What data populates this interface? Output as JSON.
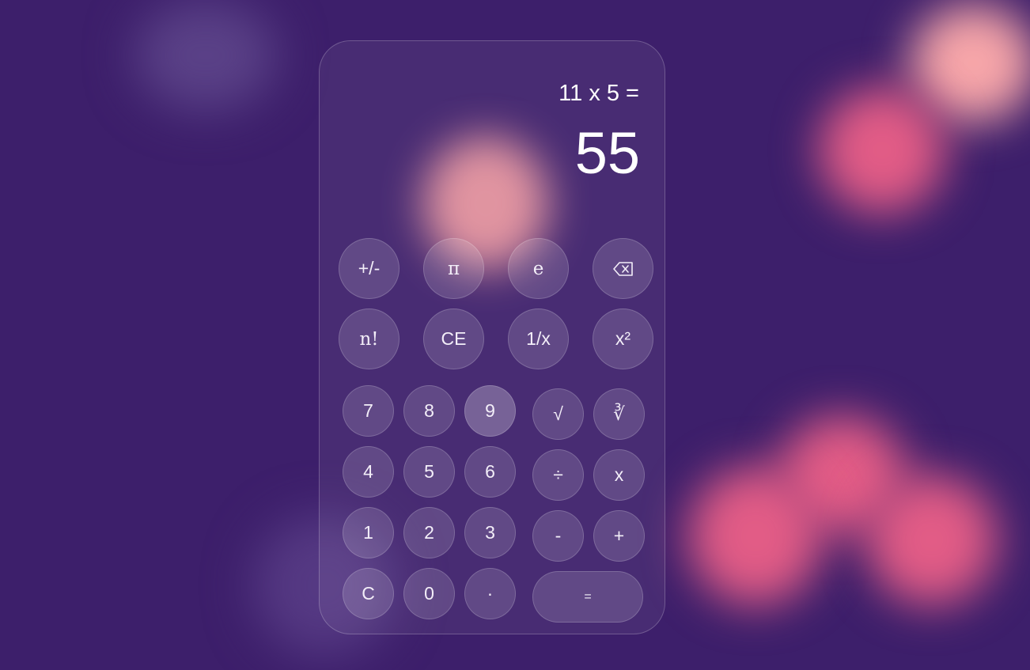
{
  "display": {
    "expression": "11 x 5 =",
    "result": "55"
  },
  "scientific_keys": {
    "sign": "+/-",
    "pi": "π",
    "e": "e",
    "backspace_icon": "backspace-icon",
    "factorial": "n!",
    "clear_entry": "CE",
    "reciprocal": "1/x",
    "square": "x²"
  },
  "digits": [
    "7",
    "8",
    "9",
    "4",
    "5",
    "6",
    "1",
    "2",
    "3",
    "0"
  ],
  "keys": {
    "clear": "C",
    "decimal": "·",
    "sqrt": "√",
    "cbrt": "∛",
    "divide": "÷",
    "multiply": "x",
    "subtract": "-",
    "add": "+",
    "equals": "="
  },
  "colors": {
    "background": "#3d1f6b",
    "accent_pink": "#e25c86",
    "accent_peach": "#f7a6a9"
  }
}
